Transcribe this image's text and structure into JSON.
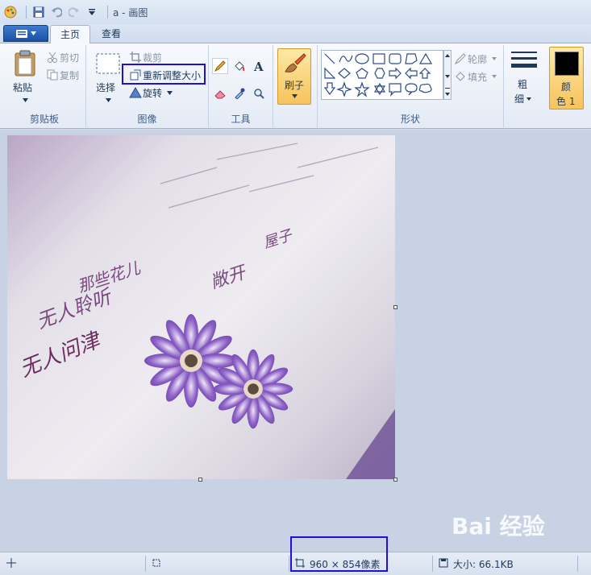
{
  "window": {
    "title": "a - 画图"
  },
  "tabs": {
    "file_label": "",
    "home": "主页",
    "view": "查看"
  },
  "clipboard": {
    "paste": "粘贴",
    "cut": "剪切",
    "copy": "复制",
    "group_label": "剪贴板"
  },
  "image": {
    "select": "选择",
    "crop": "裁剪",
    "resize": "重新调整大小",
    "rotate": "旋转",
    "group_label": "图像"
  },
  "tools": {
    "group_label": "工具"
  },
  "brushes": {
    "label": "刷子"
  },
  "shapes": {
    "outline": "轮廓",
    "fill": "填充",
    "group_label": "形状"
  },
  "size": {
    "label_1": "粗",
    "label_2": "细"
  },
  "color1": {
    "label_1": "颜",
    "label_2": "色 1",
    "value": "#000000"
  },
  "canvas_image": {
    "handwriting": [
      "那些花儿",
      "无人聆听",
      "无人问津",
      "敞开",
      "屋子"
    ]
  },
  "status": {
    "dimensions": "960 × 854像素",
    "file_size": "大小: 66.1KB"
  },
  "watermark": "Bai 经验",
  "colors": {
    "highlight": "#1f10d8",
    "flower": "#7b4fb5"
  }
}
